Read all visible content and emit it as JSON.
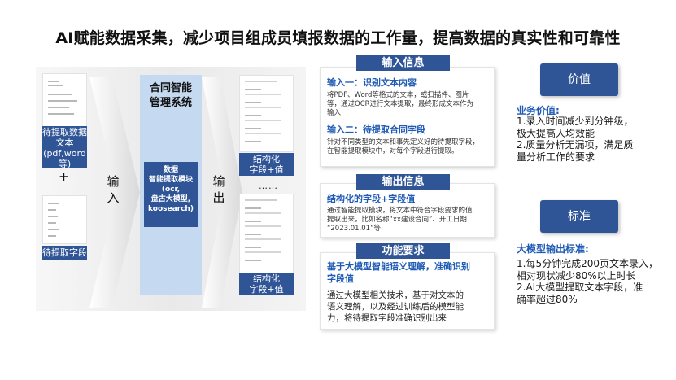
{
  "title": "AI赋能数据采集，减少项目组成员填报数据的工作量，提高数据的真实性和可靠性",
  "diagram": {
    "input_doc_label": [
      "待提取数据",
      "文本",
      "(pdf,word",
      "等)"
    ],
    "plus": "+",
    "fields_label": "待提取字段",
    "input_arrow": [
      "输",
      "入"
    ],
    "output_arrow": [
      "输",
      "出"
    ],
    "system_title": [
      "合同智能",
      "管理系统"
    ],
    "module_label": [
      "数据",
      "智能提取模块",
      "(ocr,",
      "盘古大模型,",
      "koosearch)"
    ],
    "output_label_1": [
      "结构化",
      "字段+值"
    ],
    "ellipsis": "……",
    "output_label_2": [
      "结构化",
      "字段+值"
    ]
  },
  "input_info": {
    "heading": "输入信息",
    "sub1": "输入一：识别文本内容",
    "body1": [
      "将PDF、Word等格式的文本，或扫描件、图片",
      "等，通过OCR进行文本提取，最终形成文本作为",
      "输入"
    ],
    "sub2": "输入二：待提取合同字段",
    "body2": [
      "针对不同类型的文本和事先定义好的待提取字段，",
      "在智能提取模块中，对每个字段进行提取。"
    ]
  },
  "output_info": {
    "heading": "输出信息",
    "sub": "结构化的字段+字段值",
    "body": [
      "通过智能提取模块，将文本中符合字段要求的值",
      "提取出来，比如名称“xx建设合同”、开工日期",
      "“2023.01.01”等"
    ]
  },
  "func_req": {
    "heading": "功能要求",
    "sub": [
      "基于大模型智能语义理解，准确识别",
      "字段值"
    ],
    "body": [
      "通过大模型相关技术，基于对文本的",
      "语义理解，以及经过训练后的模型能",
      "力，将待提取字段准确识别出来"
    ]
  },
  "value": {
    "pill": "价值",
    "heading": "业务价值:",
    "lines": [
      "1.录入时间减少到分钟级，",
      "极大提高人均效能",
      "2.质量分析无漏项，满足质",
      "量分析工作的要求"
    ]
  },
  "standard": {
    "pill": "标准",
    "heading": "大模型输出标准:",
    "lines": [
      "1.每5分钟完成200页文本录入，",
      "相对现状减少80%以上时长",
      "2.AI大模型提取文本字段，准",
      "确率超过80%"
    ]
  }
}
